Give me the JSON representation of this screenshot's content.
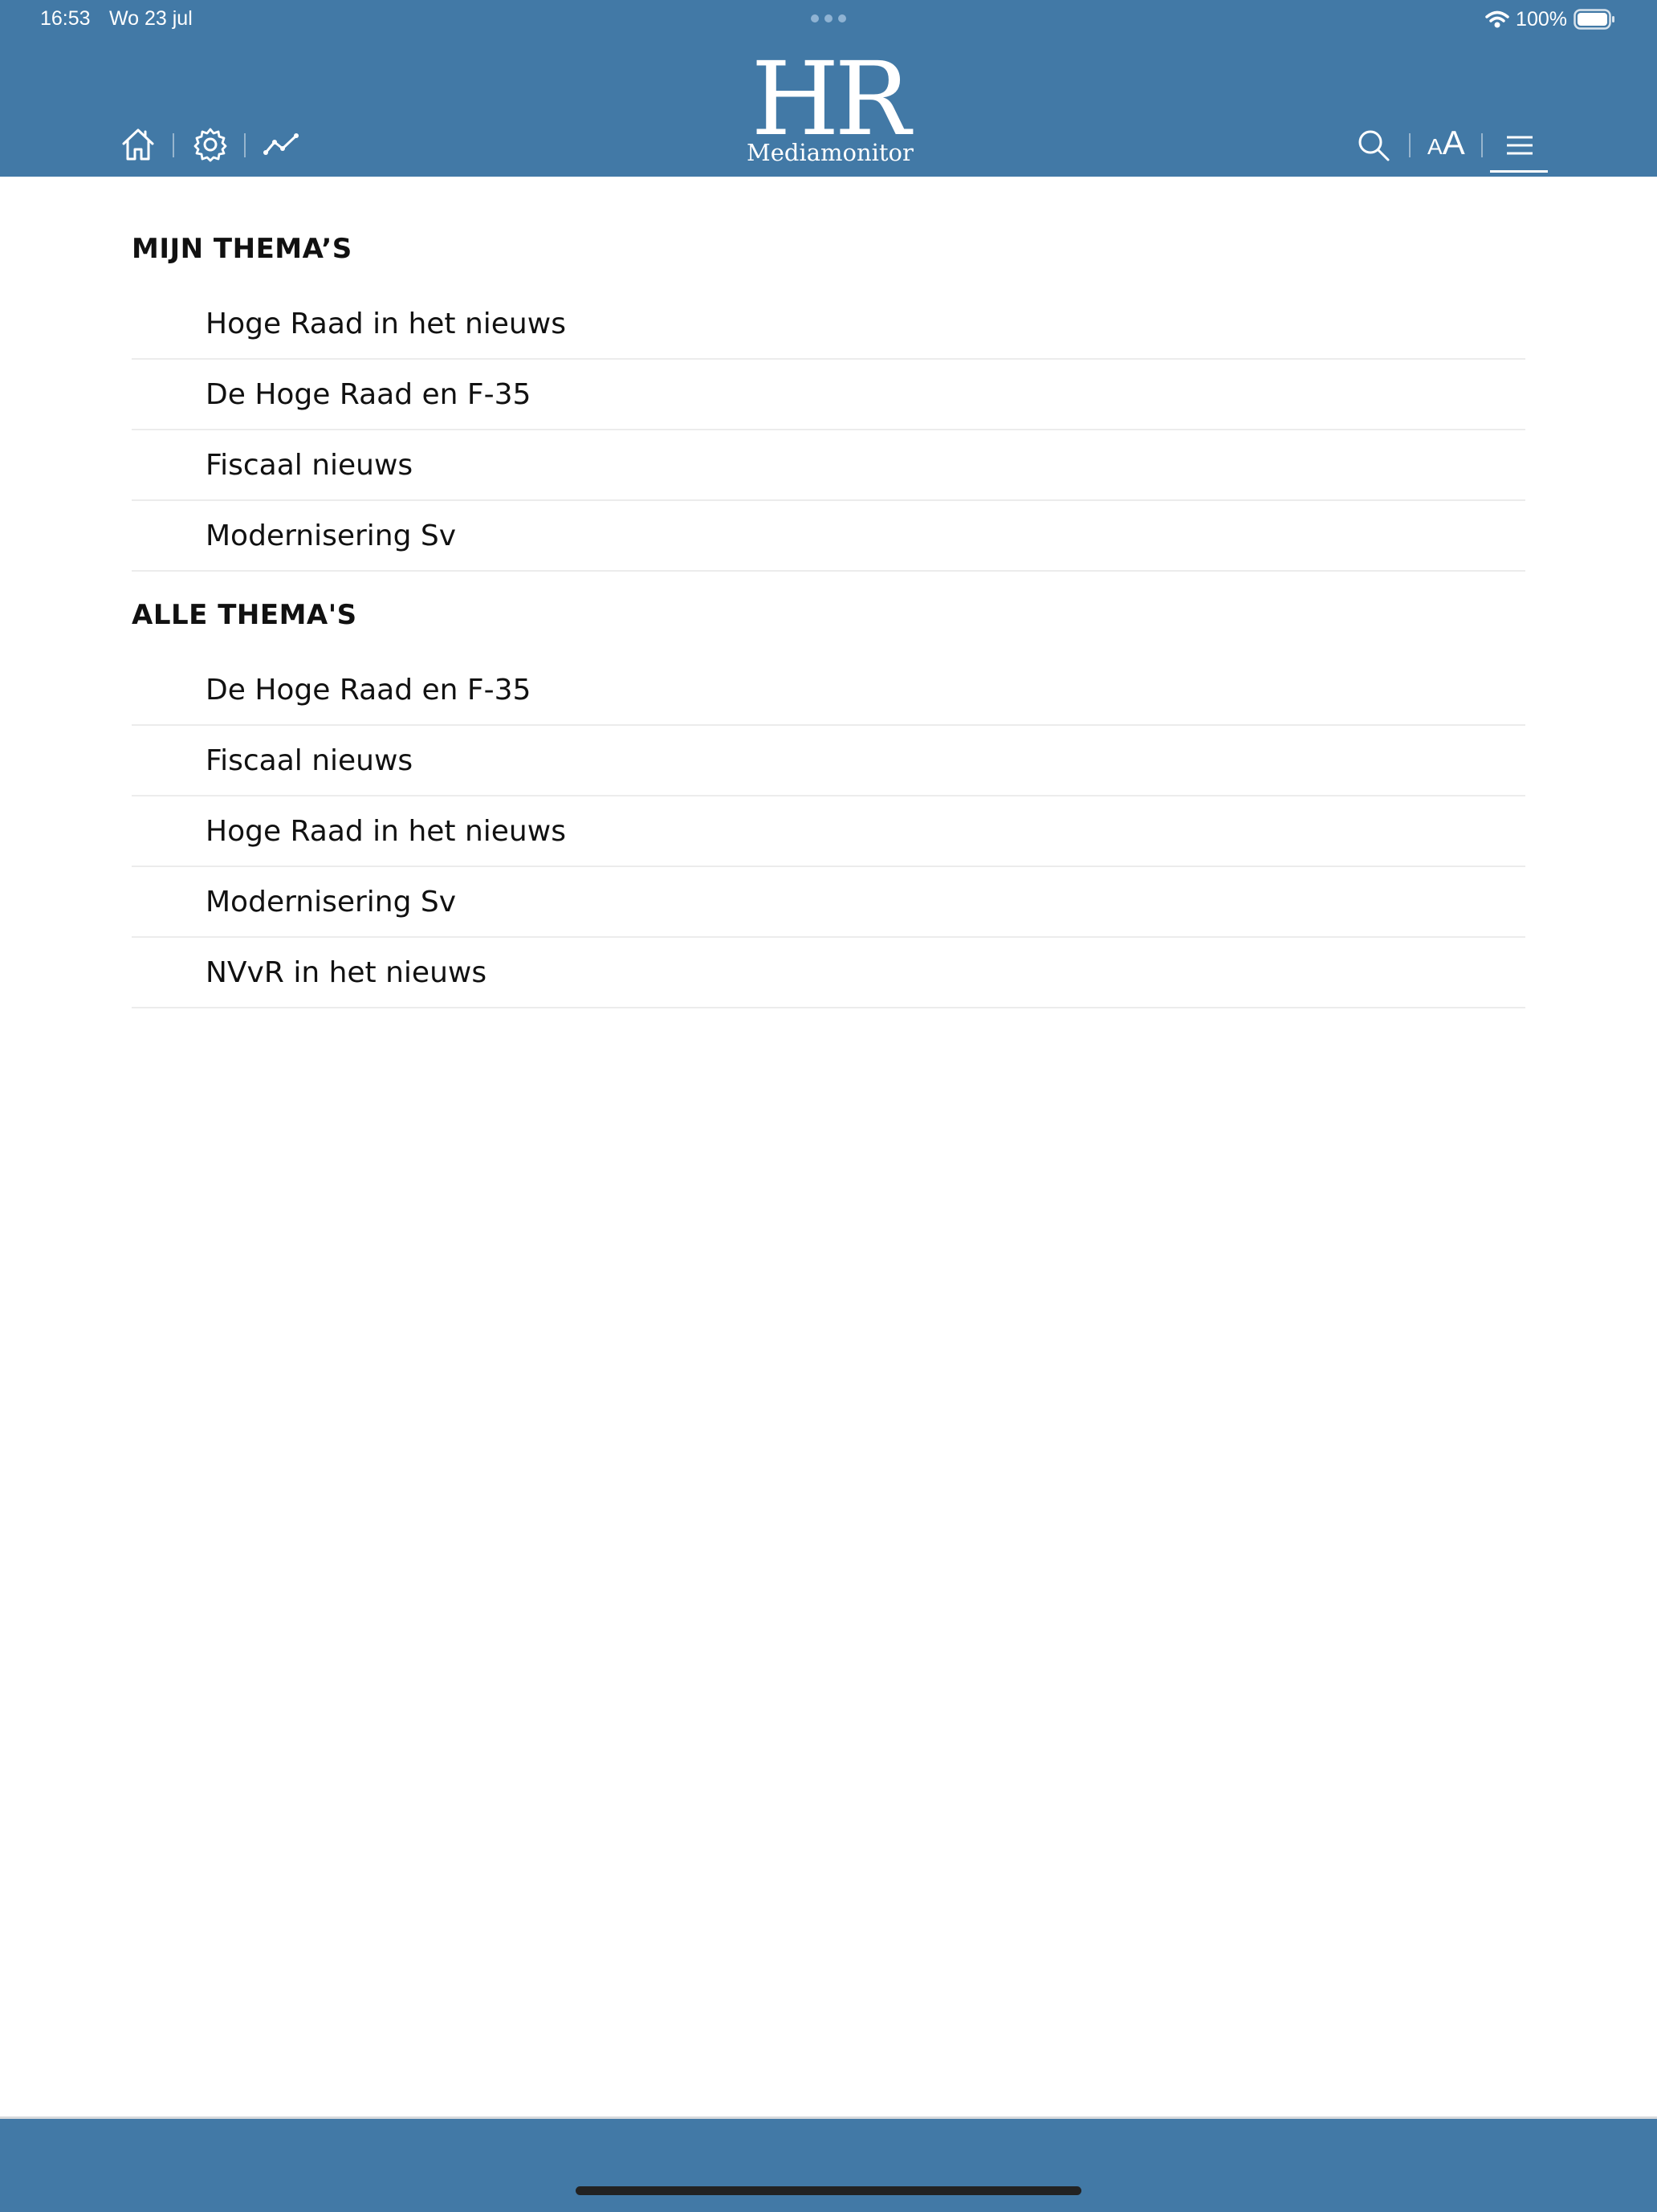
{
  "status_bar": {
    "time": "16:53",
    "date": "Wo 23 jul",
    "battery": "100%"
  },
  "header": {
    "logo_main": "HR",
    "logo_sub": "Mediamonitor",
    "font_small": "A",
    "font_big": "A",
    "icons": [
      "home-icon",
      "gear-icon",
      "trend-icon",
      "search-icon",
      "font-size-icon",
      "hamburger-menu-icon"
    ]
  },
  "mijn_themas": {
    "title": "MIJN THEMA’S",
    "items": [
      "Hoge Raad in het nieuws",
      "De Hoge Raad en F-35",
      "Fiscaal nieuws",
      "Modernisering Sv"
    ]
  },
  "alle_themas": {
    "title": "ALLE THEMA'S",
    "items": [
      "De Hoge Raad en F-35",
      "Fiscaal nieuws",
      "Hoge Raad in het nieuws",
      "Modernisering Sv",
      "NVvR in het nieuws"
    ]
  },
  "colors": {
    "brand": "#4279a6",
    "text": "#111111",
    "divider": "#ececec"
  }
}
